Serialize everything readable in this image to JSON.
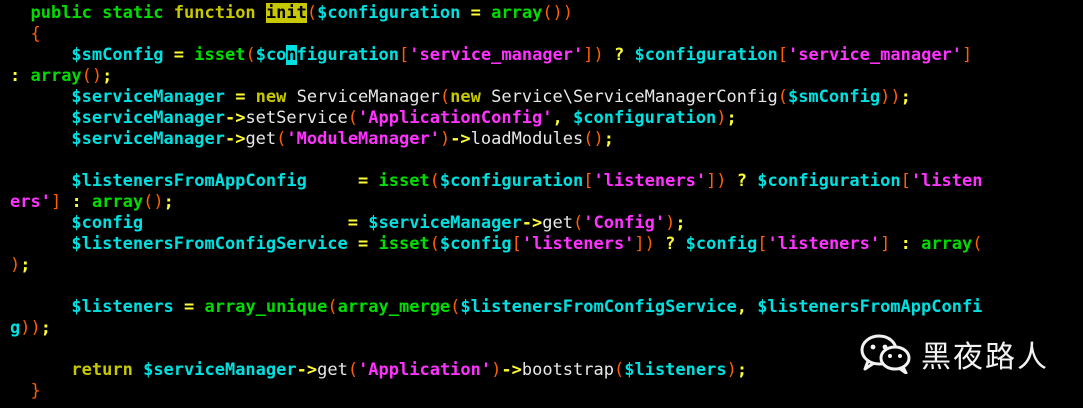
{
  "editor": {
    "lines": [
      [
        {
          "t": "  ",
          "c": "plain"
        },
        {
          "t": "public static ",
          "c": "kw"
        },
        {
          "t": "function ",
          "c": "fn"
        },
        {
          "t": "init",
          "c": "hl"
        },
        {
          "t": "(",
          "c": "paren"
        },
        {
          "t": "$configuration",
          "c": "var"
        },
        {
          "t": " = ",
          "c": "op"
        },
        {
          "t": "array",
          "c": "kw"
        },
        {
          "t": "())",
          "c": "paren"
        }
      ],
      [
        {
          "t": "  ",
          "c": "plain"
        },
        {
          "t": "{",
          "c": "paren"
        }
      ],
      [
        {
          "t": "      ",
          "c": "plain"
        },
        {
          "t": "$smConfig",
          "c": "var"
        },
        {
          "t": " = ",
          "c": "op"
        },
        {
          "t": "isset",
          "c": "kw"
        },
        {
          "t": "(",
          "c": "paren"
        },
        {
          "t": "$co",
          "c": "var"
        },
        {
          "t": "n",
          "c": "cursor"
        },
        {
          "t": "figuration",
          "c": "var"
        },
        {
          "t": "[",
          "c": "paren"
        },
        {
          "t": "'service_manager'",
          "c": "str"
        },
        {
          "t": "])",
          "c": "paren"
        },
        {
          "t": " ? ",
          "c": "op"
        },
        {
          "t": "$configuration",
          "c": "var"
        },
        {
          "t": "[",
          "c": "paren"
        },
        {
          "t": "'service_manager'",
          "c": "str"
        },
        {
          "t": "]",
          "c": "paren"
        }
      ],
      [
        {
          "t": ": ",
          "c": "op"
        },
        {
          "t": "array",
          "c": "kw"
        },
        {
          "t": "()",
          "c": "paren"
        },
        {
          "t": ";",
          "c": "op"
        }
      ],
      [
        {
          "t": "      ",
          "c": "plain"
        },
        {
          "t": "$serviceManager",
          "c": "var"
        },
        {
          "t": " = ",
          "c": "op"
        },
        {
          "t": "new ",
          "c": "fn"
        },
        {
          "t": "ServiceManager",
          "c": "plain"
        },
        {
          "t": "(",
          "c": "paren"
        },
        {
          "t": "new ",
          "c": "fn"
        },
        {
          "t": "Service\\ServiceManagerConfig",
          "c": "plain"
        },
        {
          "t": "(",
          "c": "paren"
        },
        {
          "t": "$smConfig",
          "c": "var"
        },
        {
          "t": "))",
          "c": "paren"
        },
        {
          "t": ";",
          "c": "op"
        }
      ],
      [
        {
          "t": "      ",
          "c": "plain"
        },
        {
          "t": "$serviceManager",
          "c": "var"
        },
        {
          "t": "->",
          "c": "op"
        },
        {
          "t": "setService",
          "c": "plain"
        },
        {
          "t": "(",
          "c": "paren"
        },
        {
          "t": "'ApplicationConfig'",
          "c": "str"
        },
        {
          "t": ", ",
          "c": "op"
        },
        {
          "t": "$configuration",
          "c": "var"
        },
        {
          "t": ")",
          "c": "paren"
        },
        {
          "t": ";",
          "c": "op"
        }
      ],
      [
        {
          "t": "      ",
          "c": "plain"
        },
        {
          "t": "$serviceManager",
          "c": "var"
        },
        {
          "t": "->",
          "c": "op"
        },
        {
          "t": "get",
          "c": "plain"
        },
        {
          "t": "(",
          "c": "paren"
        },
        {
          "t": "'ModuleManager'",
          "c": "str"
        },
        {
          "t": ")",
          "c": "paren"
        },
        {
          "t": "->",
          "c": "op"
        },
        {
          "t": "loadModules",
          "c": "plain"
        },
        {
          "t": "()",
          "c": "paren"
        },
        {
          "t": ";",
          "c": "op"
        }
      ],
      [],
      [
        {
          "t": "      ",
          "c": "plain"
        },
        {
          "t": "$listenersFromAppConfig",
          "c": "var"
        },
        {
          "t": "     = ",
          "c": "op"
        },
        {
          "t": "isset",
          "c": "kw"
        },
        {
          "t": "(",
          "c": "paren"
        },
        {
          "t": "$configuration",
          "c": "var"
        },
        {
          "t": "[",
          "c": "paren"
        },
        {
          "t": "'listeners'",
          "c": "str"
        },
        {
          "t": "])",
          "c": "paren"
        },
        {
          "t": " ? ",
          "c": "op"
        },
        {
          "t": "$configuration",
          "c": "var"
        },
        {
          "t": "[",
          "c": "paren"
        },
        {
          "t": "'listen",
          "c": "str"
        }
      ],
      [
        {
          "t": "ers'",
          "c": "str"
        },
        {
          "t": "]",
          "c": "paren"
        },
        {
          "t": " : ",
          "c": "op"
        },
        {
          "t": "array",
          "c": "kw"
        },
        {
          "t": "()",
          "c": "paren"
        },
        {
          "t": ";",
          "c": "op"
        }
      ],
      [
        {
          "t": "      ",
          "c": "plain"
        },
        {
          "t": "$config",
          "c": "var"
        },
        {
          "t": "                    = ",
          "c": "op"
        },
        {
          "t": "$serviceManager",
          "c": "var"
        },
        {
          "t": "->",
          "c": "op"
        },
        {
          "t": "get",
          "c": "plain"
        },
        {
          "t": "(",
          "c": "paren"
        },
        {
          "t": "'Config'",
          "c": "str"
        },
        {
          "t": ")",
          "c": "paren"
        },
        {
          "t": ";",
          "c": "op"
        }
      ],
      [
        {
          "t": "      ",
          "c": "plain"
        },
        {
          "t": "$listenersFromConfigService",
          "c": "var"
        },
        {
          "t": " = ",
          "c": "op"
        },
        {
          "t": "isset",
          "c": "kw"
        },
        {
          "t": "(",
          "c": "paren"
        },
        {
          "t": "$config",
          "c": "var"
        },
        {
          "t": "[",
          "c": "paren"
        },
        {
          "t": "'listeners'",
          "c": "str"
        },
        {
          "t": "])",
          "c": "paren"
        },
        {
          "t": " ? ",
          "c": "op"
        },
        {
          "t": "$config",
          "c": "var"
        },
        {
          "t": "[",
          "c": "paren"
        },
        {
          "t": "'listeners'",
          "c": "str"
        },
        {
          "t": "]",
          "c": "paren"
        },
        {
          "t": " : ",
          "c": "op"
        },
        {
          "t": "array",
          "c": "kw"
        },
        {
          "t": "(",
          "c": "paren"
        }
      ],
      [
        {
          "t": ")",
          "c": "paren"
        },
        {
          "t": ";",
          "c": "op"
        }
      ],
      [],
      [
        {
          "t": "      ",
          "c": "plain"
        },
        {
          "t": "$listeners",
          "c": "var"
        },
        {
          "t": " = ",
          "c": "op"
        },
        {
          "t": "array_unique",
          "c": "kw"
        },
        {
          "t": "(",
          "c": "paren"
        },
        {
          "t": "array_merge",
          "c": "kw"
        },
        {
          "t": "(",
          "c": "paren"
        },
        {
          "t": "$listenersFromConfigService",
          "c": "var"
        },
        {
          "t": ", ",
          "c": "op"
        },
        {
          "t": "$listenersFromAppConfi",
          "c": "var"
        }
      ],
      [
        {
          "t": "g",
          "c": "var"
        },
        {
          "t": "))",
          "c": "paren"
        },
        {
          "t": ";",
          "c": "op"
        }
      ],
      [],
      [
        {
          "t": "      ",
          "c": "plain"
        },
        {
          "t": "return ",
          "c": "fn"
        },
        {
          "t": "$serviceManager",
          "c": "var"
        },
        {
          "t": "->",
          "c": "op"
        },
        {
          "t": "get",
          "c": "plain"
        },
        {
          "t": "(",
          "c": "paren"
        },
        {
          "t": "'Application'",
          "c": "str"
        },
        {
          "t": ")",
          "c": "paren"
        },
        {
          "t": "->",
          "c": "op"
        },
        {
          "t": "bootstrap",
          "c": "plain"
        },
        {
          "t": "(",
          "c": "paren"
        },
        {
          "t": "$listeners",
          "c": "var"
        },
        {
          "t": ")",
          "c": "paren"
        },
        {
          "t": ";",
          "c": "op"
        }
      ],
      [
        {
          "t": "  ",
          "c": "plain"
        },
        {
          "t": "}",
          "c": "paren"
        }
      ]
    ]
  },
  "watermark": {
    "text": "黑夜路人",
    "icon": "wechat-icon"
  }
}
